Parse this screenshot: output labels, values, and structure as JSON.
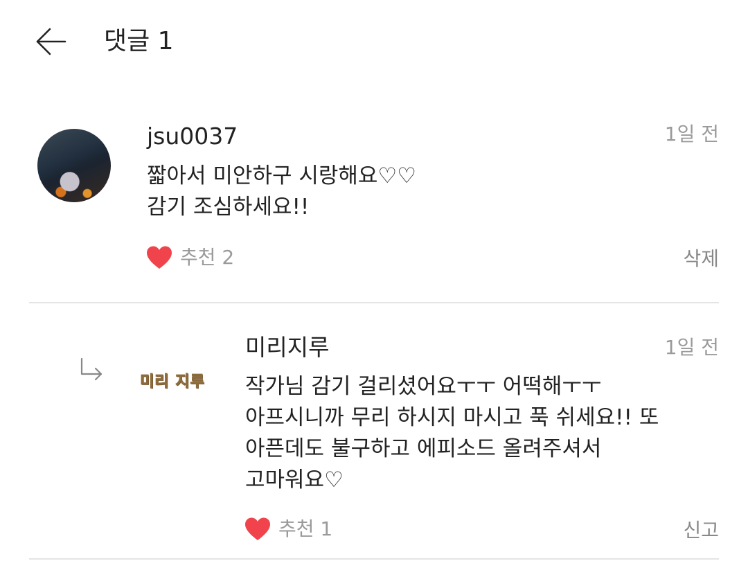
{
  "header": {
    "title": "댓글 1",
    "back_icon": "arrow-left-icon"
  },
  "comments": [
    {
      "username": "jsu0037",
      "time": "1일 전",
      "body": "짧아서 미안하구 시랑해요♡♡\n감기 조심하세요!!",
      "like_label": "추천 2",
      "action_label": "삭제",
      "avatar": "profile-photo"
    },
    {
      "username": "미리지루",
      "time": "1일 전",
      "body": "작가님 감기 걸리셨어요ㅜㅜ 어떡해ㅜㅜ\n아프시니까 무리 하시지 마시고 푹 쉬세요!! 또\n아픈데도 불구하고 에피소드 올려주셔서\n고마워요♡",
      "like_label": "추천 1",
      "action_label": "신고",
      "avatar_text": "미리 지루",
      "is_reply": true
    }
  ],
  "colors": {
    "heart": "#f0434b",
    "muted_text": "#9a9a9a",
    "divider": "#e4e4e4"
  }
}
